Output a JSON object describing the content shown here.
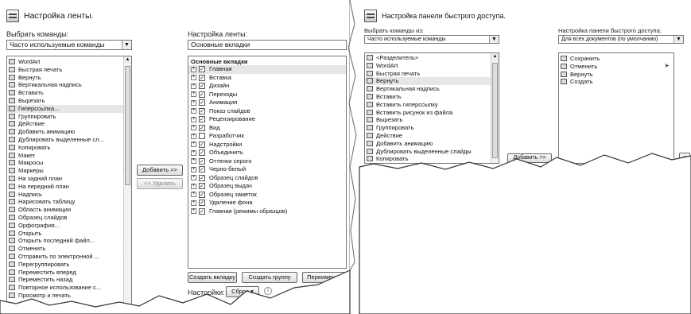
{
  "ribbon": {
    "title": "Настройка ленты.",
    "choose_label": "Выбрать команды:",
    "choose_value": "Часто используемые команды",
    "customize_label": "Настройка ленты:",
    "customize_value": "Основные вкладки",
    "commands": [
      {
        "label": "WordArt",
        "sub": "▸"
      },
      {
        "label": "Быстрая печать",
        "sub": ""
      },
      {
        "label": "Вернуть",
        "sub": ""
      },
      {
        "label": "Вертикальная надпись",
        "sub": ""
      },
      {
        "label": "Вставить",
        "sub": ""
      },
      {
        "label": "Вырезать",
        "sub": ""
      },
      {
        "label": "Гиперссылка...",
        "sub": ""
      },
      {
        "label": "Группировать",
        "sub": ""
      },
      {
        "label": "Действие",
        "sub": ""
      },
      {
        "label": "Добавить анимацию",
        "sub": "▸"
      },
      {
        "label": "Дублировать выделенные сл...",
        "sub": ""
      },
      {
        "label": "Копировать",
        "sub": ""
      },
      {
        "label": "Макет",
        "sub": "▸"
      },
      {
        "label": "Макросы",
        "sub": ""
      },
      {
        "label": "Маркеры",
        "sub": "|▸"
      },
      {
        "label": "На задний план",
        "sub": ""
      },
      {
        "label": "На передний план",
        "sub": ""
      },
      {
        "label": "Надпись",
        "sub": ""
      },
      {
        "label": "Нарисовать таблицу",
        "sub": ""
      },
      {
        "label": "Область анимации",
        "sub": ""
      },
      {
        "label": "Образец слайдов",
        "sub": ""
      },
      {
        "label": "Орфография...",
        "sub": ""
      },
      {
        "label": "Открыть",
        "sub": ""
      },
      {
        "label": "Открыть последний файл...",
        "sub": ""
      },
      {
        "label": "Отменить",
        "sub": "|▸"
      },
      {
        "label": "Отправить по электронной ...",
        "sub": ""
      },
      {
        "label": "Перегруппировать",
        "sub": ""
      },
      {
        "label": "Переместить вперед",
        "sub": ""
      },
      {
        "label": "Переместить назад",
        "sub": ""
      },
      {
        "label": "Повторное использование с...",
        "sub": ""
      },
      {
        "label": "Просмотр и печать",
        "sub": ""
      }
    ],
    "tabs_header": "Основные вкладки",
    "tabs": [
      {
        "label": "Главная",
        "checked": "✓"
      },
      {
        "label": "Вставка",
        "checked": "✓"
      },
      {
        "label": "Дизайн",
        "checked": "✓"
      },
      {
        "label": "Переходы",
        "checked": "✓"
      },
      {
        "label": "Анимация",
        "checked": "✓"
      },
      {
        "label": "Показ слайдов",
        "checked": "✓"
      },
      {
        "label": "Рецензирование",
        "checked": "✓"
      },
      {
        "label": "Вид",
        "checked": "✓"
      },
      {
        "label": "Разработчик",
        "checked": ""
      },
      {
        "label": "Надстройки",
        "checked": "✓"
      },
      {
        "label": "Объединить",
        "checked": "✓"
      },
      {
        "label": "Оттенки серого",
        "checked": "✓"
      },
      {
        "label": "Черно-белый",
        "checked": "✓"
      },
      {
        "label": "Образец слайдов",
        "checked": "✓"
      },
      {
        "label": "Образец выдач",
        "checked": "✓"
      },
      {
        "label": "Образец заметок",
        "checked": "✓"
      },
      {
        "label": "Удаление фона",
        "checked": "✓"
      },
      {
        "label": "Главная (режимы образцов)",
        "checked": "✓"
      }
    ],
    "add_button": "Добавить >>",
    "remove_button": "<< Удалить",
    "new_tab_button": "Создать вкладку",
    "new_group_button": "Создать группу",
    "rename_button": "Переименов",
    "settings_label": "Настройки:",
    "reset_button": "Сброс ▾"
  },
  "qat": {
    "title": "Настройка панели быстрого доступа.",
    "choose_label": "Выбрать команды из:",
    "choose_value": "Часто используемые команды",
    "customize_label": "Настройка панели быстрого доступа:",
    "customize_value": "Для всех документов (по умолчанию)",
    "commands": [
      {
        "label": "<Разделитель>",
        "sub": ""
      },
      {
        "label": "WordArt",
        "sub": "▸"
      },
      {
        "label": "Быстрая печать",
        "sub": ""
      },
      {
        "label": "Вернуть",
        "sub": ""
      },
      {
        "label": "Вертикальная надпись",
        "sub": ""
      },
      {
        "label": "Вставить",
        "sub": ""
      },
      {
        "label": "Вставить гиперссылку",
        "sub": ""
      },
      {
        "label": "Вставить рисунок из файла",
        "sub": ""
      },
      {
        "label": "Вырезать",
        "sub": ""
      },
      {
        "label": "Группировать",
        "sub": ""
      },
      {
        "label": "Действие",
        "sub": ""
      },
      {
        "label": "Добавить анимацию",
        "sub": "▸"
      },
      {
        "label": "Дублировать выделенные слайды",
        "sub": ""
      },
      {
        "label": "Копировать",
        "sub": ""
      }
    ],
    "current": [
      {
        "label": "Сохранить",
        "sub": ""
      },
      {
        "label": "Отменить",
        "sub": "|▸"
      },
      {
        "label": "Вернуть",
        "sub": ""
      },
      {
        "label": "Создать",
        "sub": ""
      }
    ],
    "add_button": "Добавить >>"
  }
}
